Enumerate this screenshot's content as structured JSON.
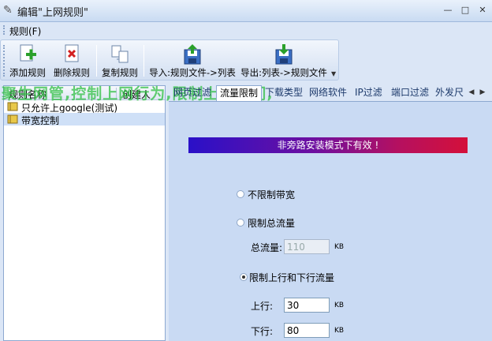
{
  "window": {
    "title": "编辑\"上网规则\"",
    "min": "—",
    "restore": "□",
    "close": "✕"
  },
  "menu": {
    "item": "规则(F)"
  },
  "toolbar": {
    "add": "添加规则",
    "delete": "删除规则",
    "copy": "复制规则",
    "import": "导入:规则文件->列表",
    "export": "导出:列表->规则文件"
  },
  "list": {
    "col_name": "规则名称",
    "col_creator": "创建人",
    "rows": [
      "只允许上google(测试)",
      "带宽控制"
    ]
  },
  "watermark": "聚生网管,控制上网行为,限制上网时间,",
  "tabs": [
    "网页过滤",
    "流量限制",
    "下载类型",
    "网络软件",
    "IP过滤",
    "端口过滤",
    "外发尺"
  ],
  "content": {
    "banner": "非旁路安装模式下有效 !",
    "opt_unlimited": "不限制带宽",
    "opt_total": "限制总流量",
    "total_label": "总流量:",
    "total_value": "110",
    "total_unit": "KB",
    "opt_updown": "限制上行和下行流量",
    "up_label": "上行:",
    "up_value": "30",
    "up_unit": "KB",
    "down_label": "下行:",
    "down_value": "80",
    "down_unit": "KB"
  }
}
